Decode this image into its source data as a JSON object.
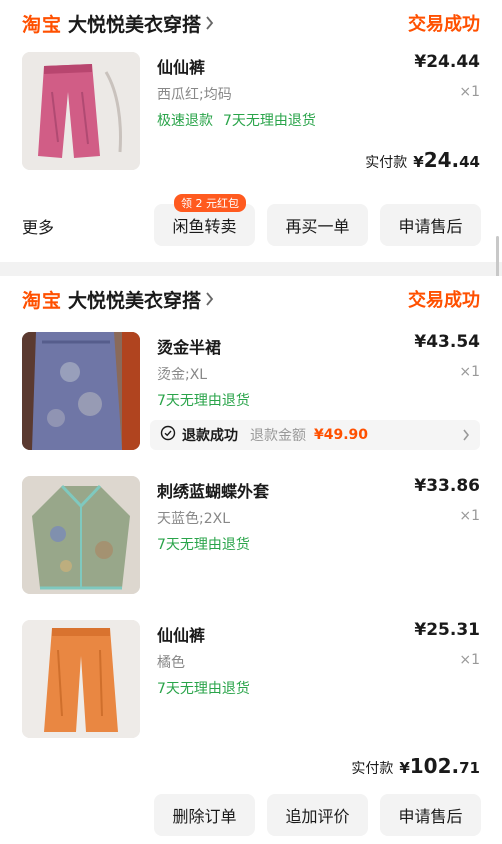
{
  "orders": [
    {
      "platform": "淘宝",
      "shop_name": "大悦悦美衣穿搭",
      "status": "交易成功",
      "items": [
        {
          "name": "仙仙裤",
          "variant": "西瓜红;均码",
          "tags": [
            "极速退款",
            "7天无理由退货"
          ],
          "price": "¥24.44",
          "qty": "×1",
          "image": "pink-pants"
        }
      ],
      "paid_label": "实付款",
      "paid_currency": "¥",
      "paid_int": "24.",
      "paid_dec": "44",
      "more_label": "更多",
      "buttons": [
        "闲鱼转卖",
        "再买一单",
        "申请售后"
      ],
      "badge": "领 2 元红包"
    },
    {
      "platform": "淘宝",
      "shop_name": "大悦悦美衣穿搭",
      "status": "交易成功",
      "items": [
        {
          "name": "烫金半裙",
          "variant": "烫金;XL",
          "tags": [
            "7天无理由退货"
          ],
          "price": "¥43.54",
          "qty": "×1",
          "image": "gold-skirt",
          "refund": {
            "status": "退款成功",
            "amount_label": "退款金额",
            "amount": "¥49.90"
          }
        },
        {
          "name": "刺绣蓝蝴蝶外套",
          "variant": "天蓝色;2XL",
          "tags": [
            "7天无理由退货"
          ],
          "price": "¥33.86",
          "qty": "×1",
          "image": "embroidered-jacket"
        },
        {
          "name": "仙仙裤",
          "variant": "橘色",
          "tags": [
            "7天无理由退货"
          ],
          "price": "¥25.31",
          "qty": "×1",
          "image": "orange-pants"
        }
      ],
      "paid_label": "实付款",
      "paid_currency": "¥",
      "paid_int": "102.",
      "paid_dec": "71",
      "buttons": [
        "删除订单",
        "追加评价",
        "申请售后"
      ]
    }
  ],
  "colors": {
    "accent": "#ff5000",
    "tag_green": "#2aa44a",
    "muted": "#888888",
    "button_bg": "#f3f3f3",
    "page_bg": "#f2f2f2"
  }
}
